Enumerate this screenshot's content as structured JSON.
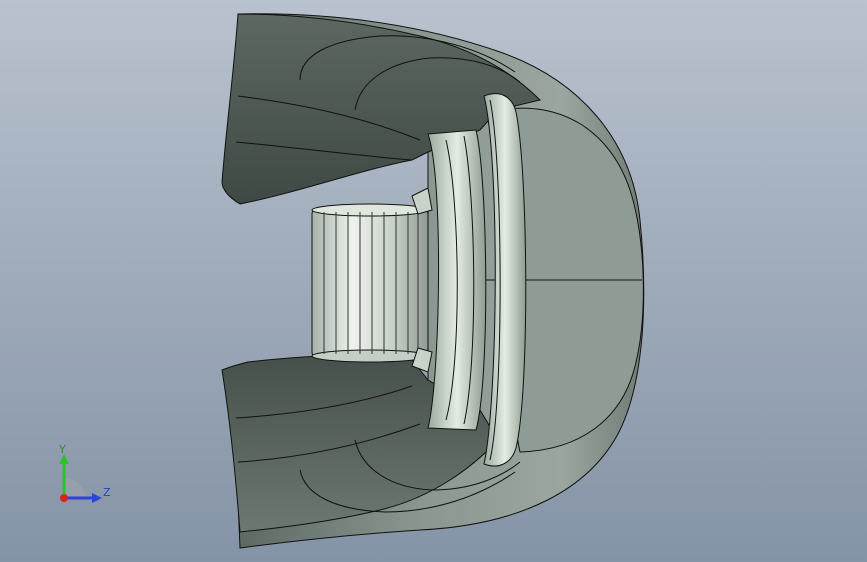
{
  "viewport": {
    "background_top": "#b9c2ce",
    "background_bottom": "#8493a6"
  },
  "model": {
    "body_color": "#7f8c86",
    "shade_color": "#4f5a54",
    "highlight_color": "#dfe7dd",
    "edge_color": "#111111"
  },
  "triad": {
    "y_label": "Y",
    "z_label": "Z",
    "y_color": "#2fbf2f",
    "z_color": "#2a43d8",
    "x_color": "#e02020",
    "origin_icon": "origin-dot-icon",
    "view_icon": "view-orientation-icon"
  }
}
